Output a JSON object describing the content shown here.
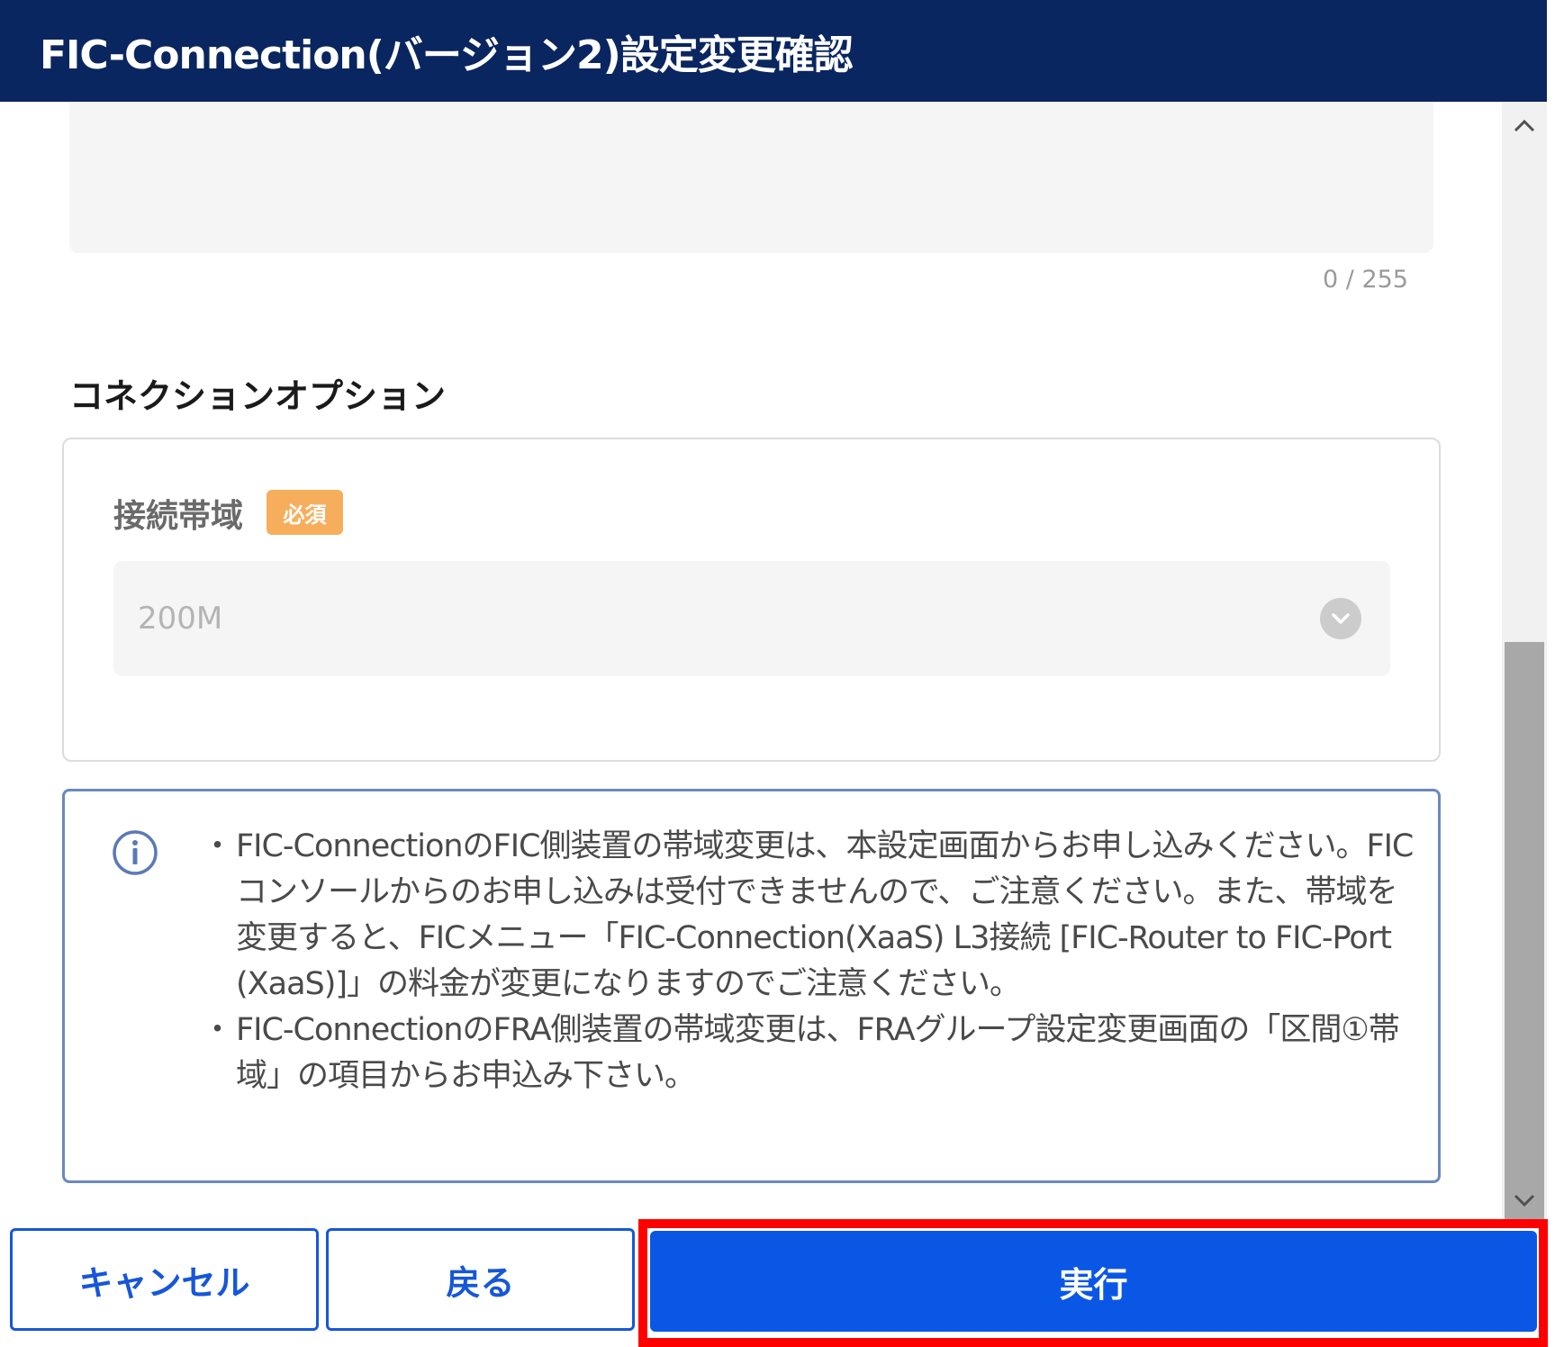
{
  "dialog": {
    "title": "FIC-Connection(バージョン2)設定変更確認"
  },
  "remarks": {
    "char_count": "0 / 255"
  },
  "connection_option": {
    "section_title": "コネクションオプション",
    "bandwidth": {
      "label": "接続帯域",
      "required_badge": "必須",
      "selected_value": "200M"
    }
  },
  "notice": {
    "icon": "info-icon",
    "items": [
      "FIC-ConnectionのFIC側装置の帯域変更は、本設定画面からお申し込みください。FICコンソールからのお申し込みは受付できませんので、ご注意ください。また、帯域を変更すると、FICメニュー「FIC-Connection(XaaS) L3接続 [FIC-Router to FIC-Port (XaaS)]」の料金が変更になりますのでご注意ください。",
      "FIC-ConnectionのFRA側装置の帯域変更は、FRAグループ設定変更画面の「区間①帯域」の項目からお申込み下さい。"
    ]
  },
  "footer": {
    "cancel_label": "キャンセル",
    "back_label": "戻る",
    "execute_label": "実行"
  },
  "colors": {
    "header_bg": "#0a2660",
    "primary": "#0b57e5",
    "required_badge": "#f7ae5c",
    "info_border": "#6a89bd",
    "highlight": "#ff0000"
  }
}
